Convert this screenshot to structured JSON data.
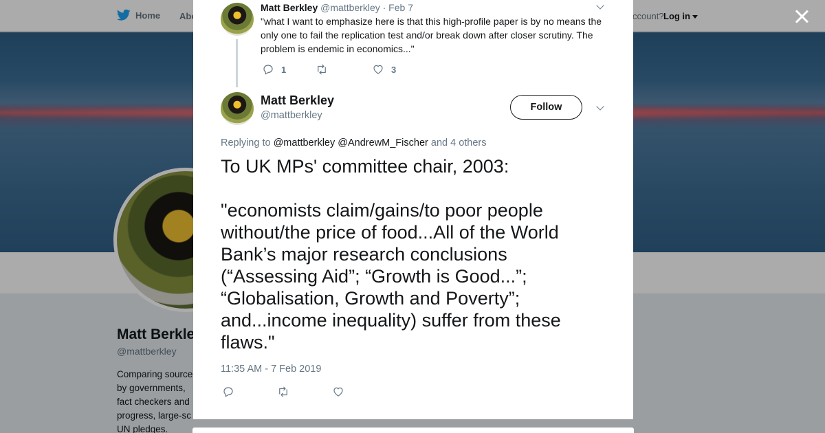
{
  "nav": {
    "home_label": "Home",
    "about_label": "Abo",
    "account_text": "ccount?",
    "login_label": "Log in"
  },
  "colors": {
    "twitter_blue": "#1da1f2",
    "text_primary": "#14171a",
    "text_secondary": "#657786"
  },
  "background_profile": {
    "name": "Matt Berkle",
    "handle": "@mattberkley",
    "bio_lines": [
      "Comparing source",
      "by governments,",
      "fact checkers and",
      "progress, large-sc",
      "UN pledges."
    ]
  },
  "parent_tweet": {
    "author": "Matt Berkley",
    "handle": "@mattberkley",
    "date": "· Feb 7",
    "text": "\"what I want to emphasize here is that this high-profile paper is by no means the only one to fail the replication test and/or break down after closer scrutiny. The problem is endemic in economics...\"",
    "reply_count": "1",
    "retweet_count": "",
    "like_count": "3"
  },
  "main_tweet": {
    "author": "Matt Berkley",
    "handle": "@mattberkley",
    "follow_label": "Follow",
    "replying_prefix": "Replying to",
    "replying_users": [
      "@mattberkley",
      "@AndrewM_Fischer"
    ],
    "replying_suffix": "and 4 others",
    "text_lines": [
      "To UK MPs' committee chair, 2003:",
      "",
      "\"economists claim/gains/to poor people without/the price of food...All of the World Bank’s major research conclusions (“Assessing Aid”; “Growth is Good...”; “Globalisation, Growth and Poverty”; and...income inequality) suffer from these flaws.\""
    ],
    "timestamp": "11:35 AM - 7 Feb 2019"
  }
}
